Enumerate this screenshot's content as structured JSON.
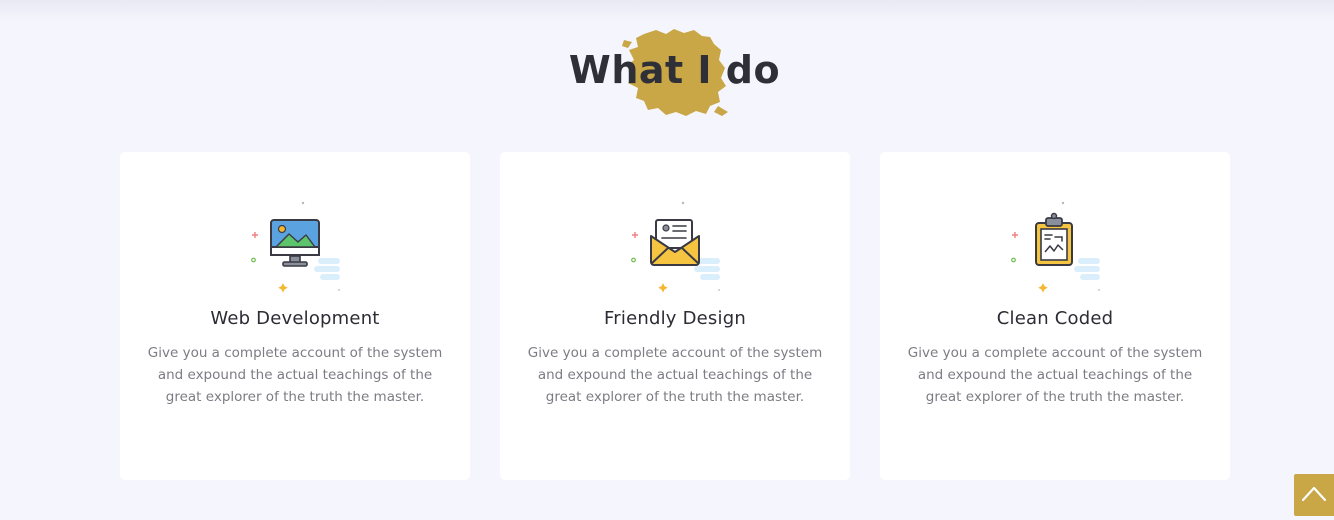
{
  "section": {
    "title": "What I do"
  },
  "colors": {
    "accent": "#c9a646",
    "background": "#f5f6fd",
    "card": "#ffffff",
    "heading": "#2f2f38",
    "body_text": "#7c7c84"
  },
  "services": [
    {
      "icon": "monitor-icon",
      "title": "Web Development",
      "description": "Give you a complete account of the system and expound the actual teachings of the great explorer of the truth the master."
    },
    {
      "icon": "envelope-icon",
      "title": "Friendly Design",
      "description": "Give you a complete account of the system and expound the actual teachings of the great explorer of the truth the master."
    },
    {
      "icon": "clipboard-icon",
      "title": "Clean Coded",
      "description": "Give you a complete account of the system and expound the actual teachings of the great explorer of the truth the master."
    }
  ],
  "scroll_top": {
    "icon": "chevron-up-icon"
  }
}
